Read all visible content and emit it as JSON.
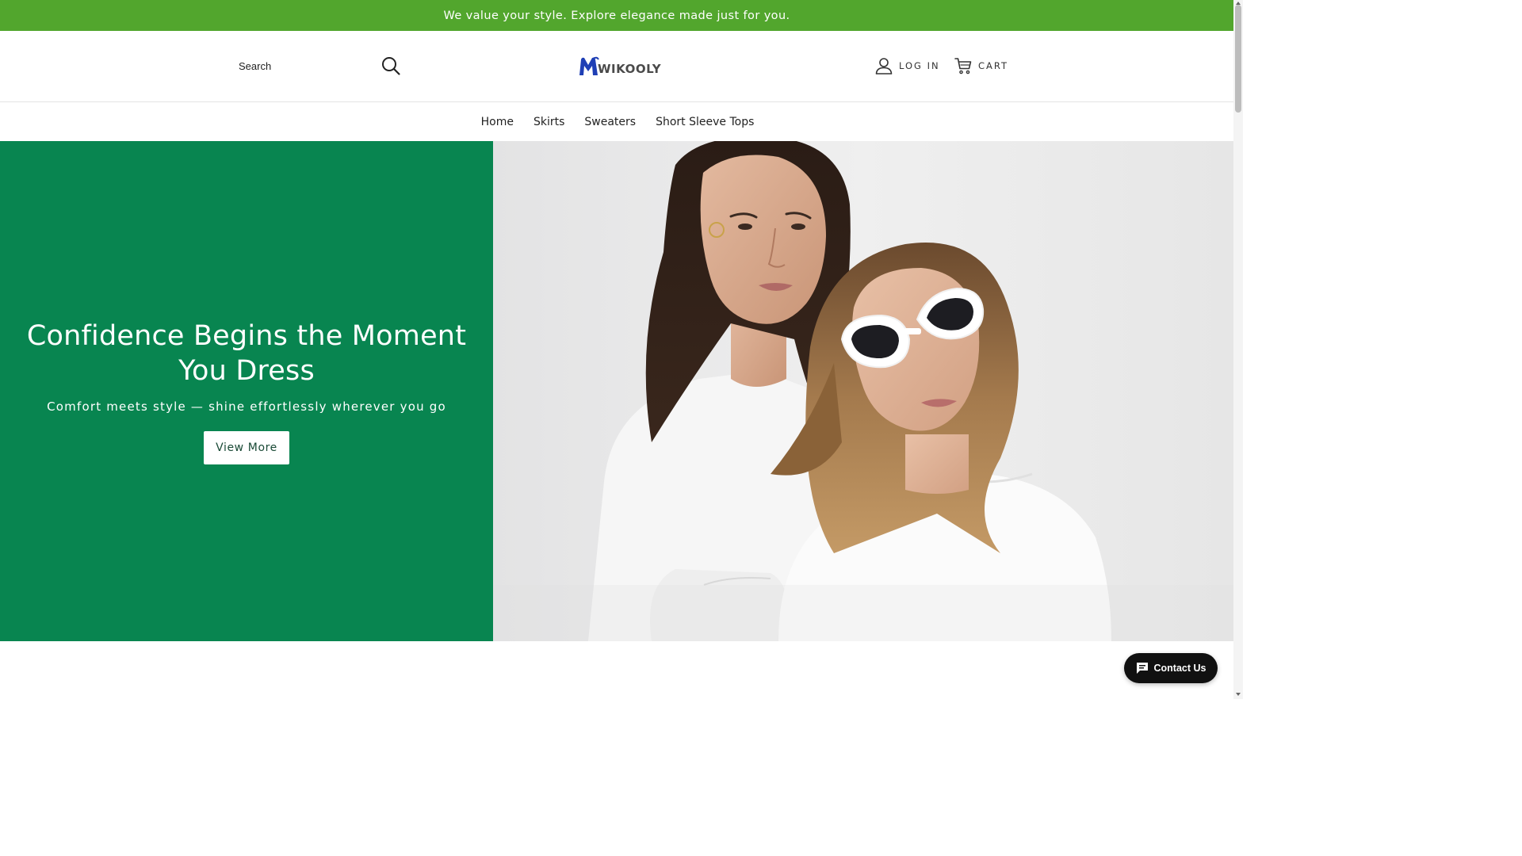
{
  "announcement": {
    "text": "We value your style. Explore elegance made just for you."
  },
  "header": {
    "search": {
      "placeholder": "Search"
    },
    "logo": {
      "text": "WIKOOLY"
    },
    "login_label": "LOG IN",
    "cart_label": "CART"
  },
  "nav": {
    "items": [
      {
        "label": "Home"
      },
      {
        "label": "Skirts"
      },
      {
        "label": "Sweaters"
      },
      {
        "label": "Short Sleeve Tops"
      }
    ]
  },
  "hero": {
    "title": "Confidence Begins the Moment You Dress",
    "subtitle": "Comfort meets style — shine effortlessly wherever you go",
    "button_label": "View More",
    "panel_color": "#088550"
  },
  "contact": {
    "label": "Contact Us"
  },
  "colors": {
    "announcement_bg": "#52a62d",
    "logo_blue": "#1f3fb5",
    "hero_green": "#088550"
  },
  "icons": {
    "search": "search-icon",
    "user": "user-icon",
    "cart": "cart-icon",
    "chat": "chat-icon"
  }
}
